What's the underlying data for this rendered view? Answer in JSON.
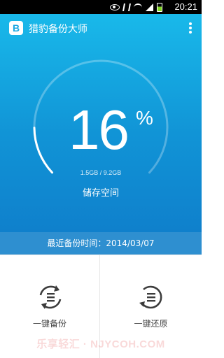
{
  "status_bar": {
    "time": "20:21",
    "icons": [
      "eye-icon",
      "no-signal-icon",
      "wifi-icon",
      "signal-icon",
      "battery-icon"
    ],
    "battery_color": "#7ed321"
  },
  "app_bar": {
    "logo_letter": "B",
    "title": "猎豹备份大师",
    "menu_icon": "more-vertical-icon"
  },
  "storage": {
    "percent_value": "16",
    "percent_sign": "%",
    "used_fraction": 0.16,
    "detail": "1.5GB / 9.2GB",
    "label": "储存空间"
  },
  "last_backup": {
    "text": "最近备份时间：2014/03/07"
  },
  "actions": [
    {
      "label": "一键备份",
      "icon": "sync-list-icon"
    },
    {
      "label": "一键还原",
      "icon": "restore-list-icon"
    }
  ],
  "watermark": "乐享轻汇 · NJYCOH.COM",
  "colors": {
    "hero_top": "#19b9ea",
    "hero_bottom": "#0f80cc",
    "backup_bar": "#2e8fd0",
    "icon_dark": "#3c3c3c"
  }
}
